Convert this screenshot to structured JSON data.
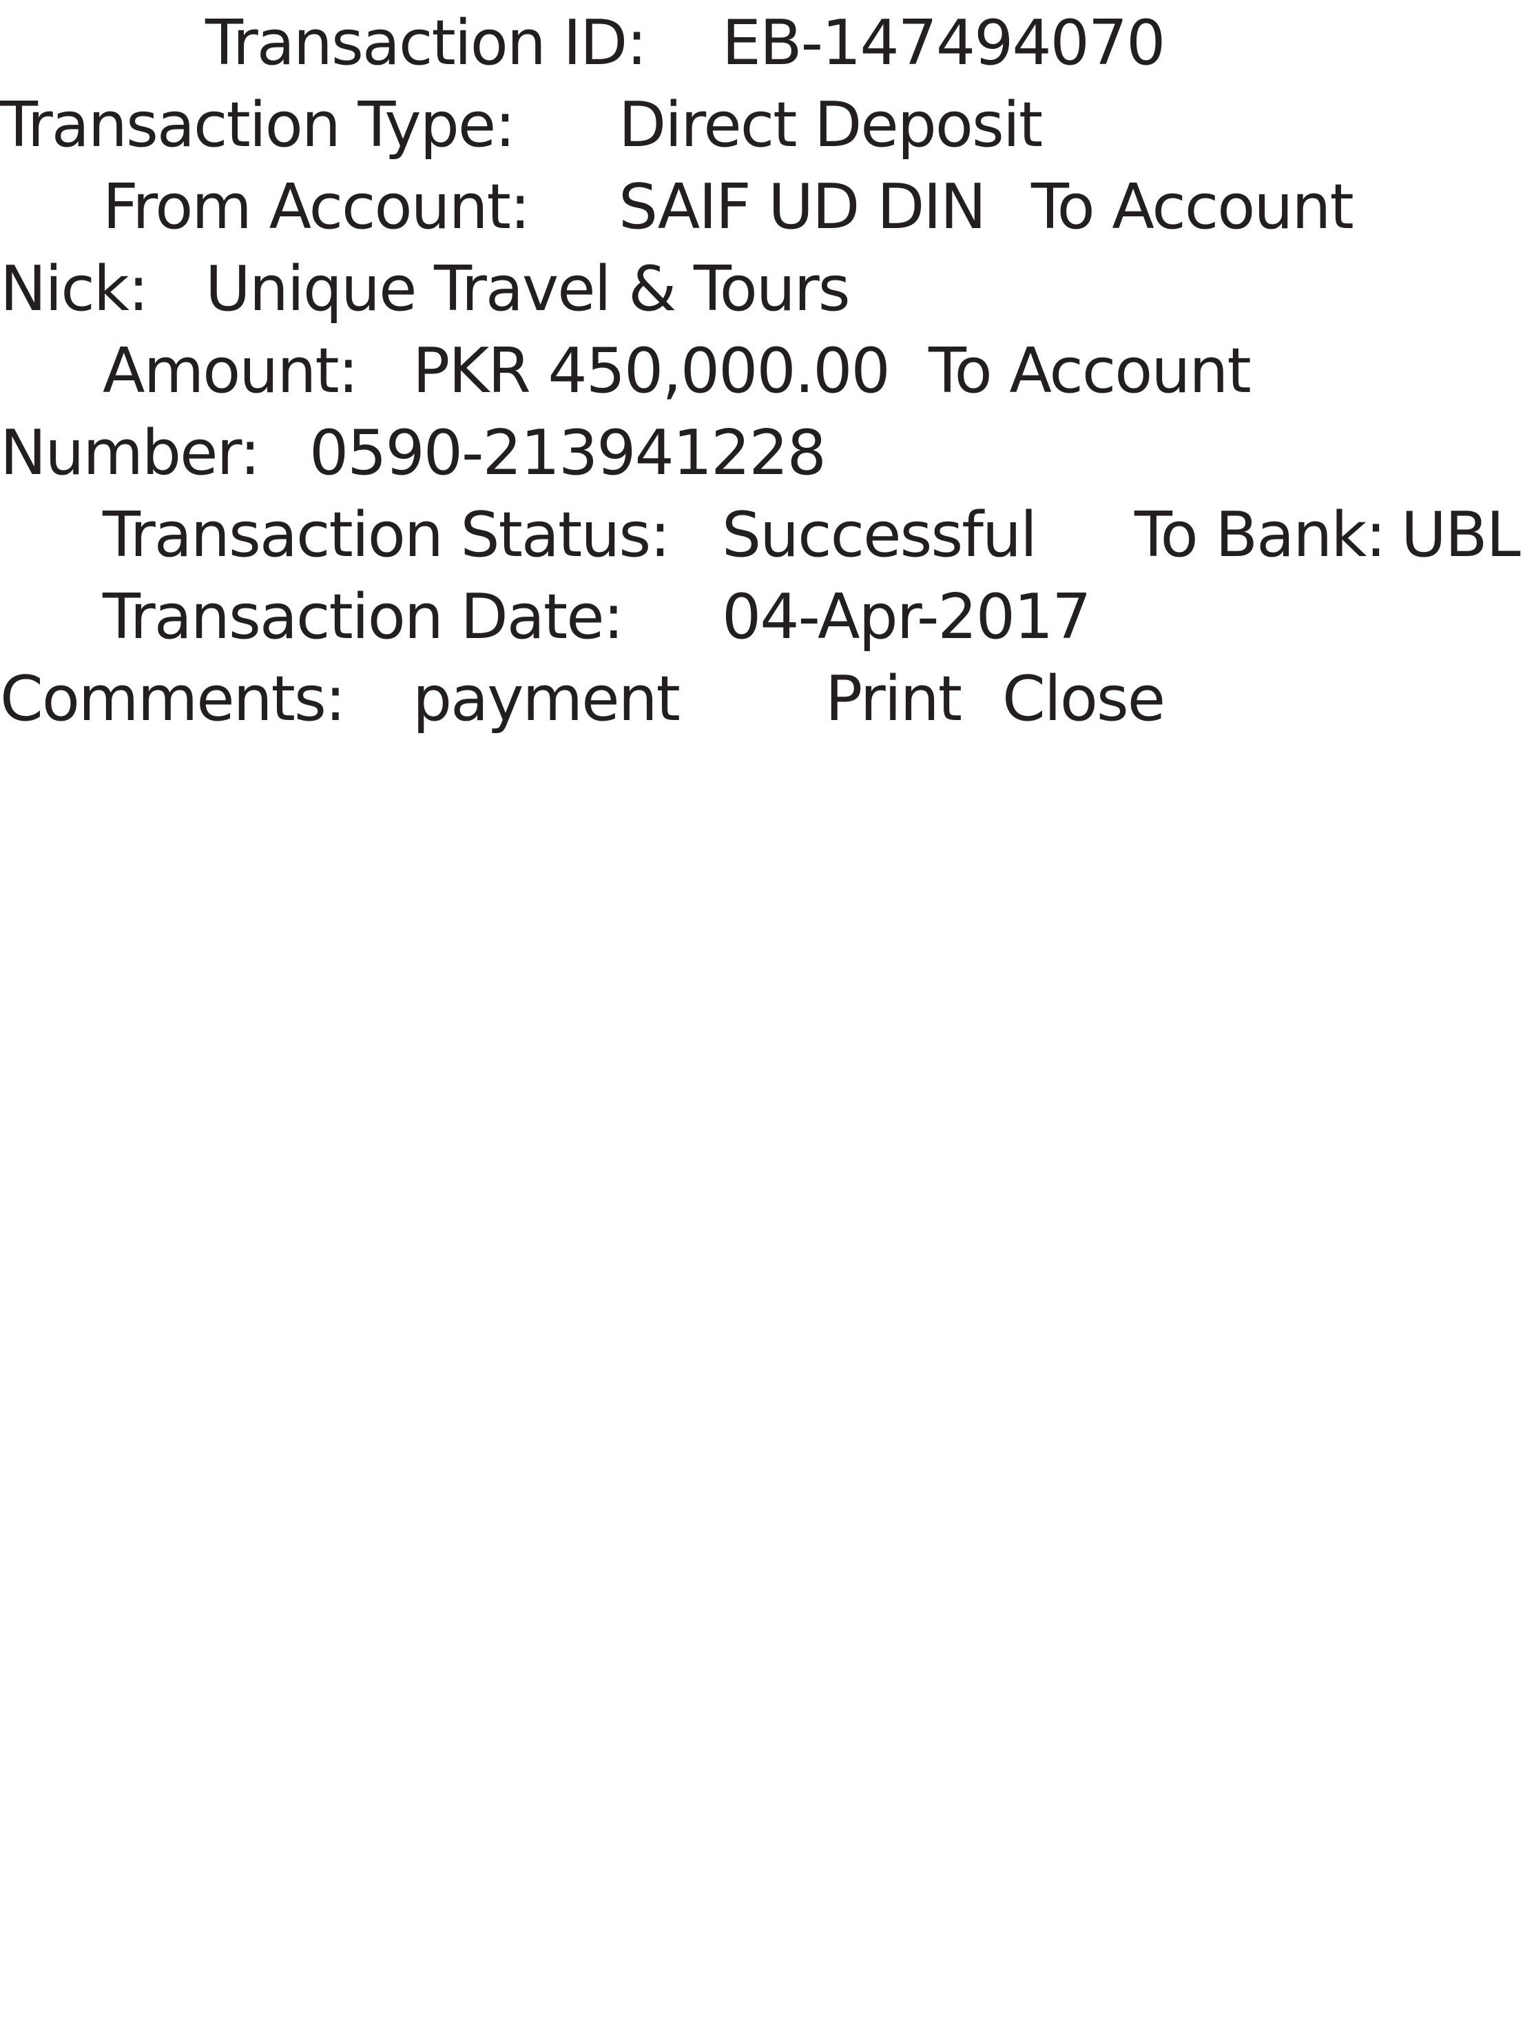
{
  "receipt": {
    "transaction_id_label": "Transaction ID:",
    "transaction_id_value": "EB-147494070",
    "transaction_type_label": "Transaction Type:",
    "transaction_type_value": "Direct Deposit",
    "from_account_label": "From Account:",
    "from_account_value": "SAIF UD DIN",
    "to_account_nick_label_part1": "To Account",
    "to_account_nick_label_part2": "Nick:",
    "to_account_nick_value": "Unique Travel & Tours",
    "amount_label": "Amount:",
    "amount_value": "PKR 450,000.00",
    "to_account_number_label_part1": "To Account",
    "to_account_number_label_part2": "Number:",
    "to_account_number_value": "0590-213941228",
    "transaction_status_label": "Transaction Status:",
    "transaction_status_value": "Successful",
    "to_bank_label": "To Bank:",
    "to_bank_value": "UBL",
    "transaction_date_label": "Transaction Date:",
    "transaction_date_value": "04-Apr-2017",
    "comments_label": "Comments:",
    "comments_value": "payment"
  },
  "actions": {
    "print_label": "Print",
    "close_label": "Close"
  }
}
